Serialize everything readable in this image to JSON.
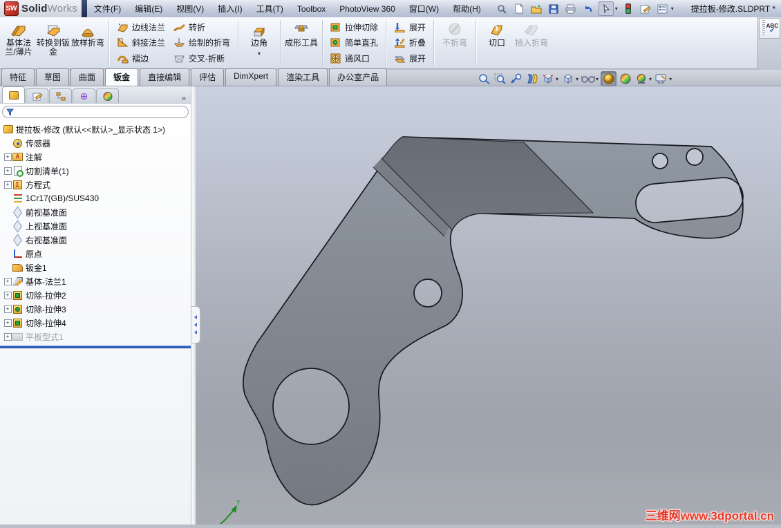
{
  "window": {
    "logo_cube": "SW",
    "app_name_bold": "Solid",
    "app_name_light": "Works",
    "doc_title": "提拉板-修改.SLDPRT *"
  },
  "menu": {
    "items": [
      "文件(F)",
      "编辑(E)",
      "视图(V)",
      "插入(I)",
      "工具(T)",
      "Toolbox",
      "PhotoView 360",
      "窗口(W)",
      "帮助(H)"
    ]
  },
  "quick_toolbar": {
    "icons": [
      "search",
      "new-document",
      "open",
      "save",
      "print",
      "undo",
      "select-cursor",
      "rebuild-traffic-light",
      "file-properties",
      "options"
    ]
  },
  "ribbon": {
    "big_buttons_left": [
      "基体法兰/薄片",
      "转换到钣金",
      "放样折弯"
    ],
    "flange_col": [
      "边线法兰",
      "斜接法兰",
      "褶边"
    ],
    "bend_col": [
      "转折",
      "绘制的折弯",
      "交叉-折断"
    ],
    "corner_button": "边角",
    "forming_button": "成形工具",
    "cut_col": [
      "拉伸切除",
      "简单直孔",
      "通风口"
    ],
    "fold_col": [
      "展开",
      "折叠",
      "展开"
    ],
    "no_bend_button": "不折弯",
    "rip_button": "切口",
    "insert_bend_button": "插入折弯",
    "spell_button": "ABC"
  },
  "command_tabs": {
    "items": [
      "特征",
      "草图",
      "曲面",
      "钣金",
      "直接编辑",
      "评估",
      "DimXpert",
      "渲染工具",
      "办公室产品"
    ],
    "active": "钣金"
  },
  "view_toolbar": {
    "icons": [
      "zoom-fit",
      "zoom-area",
      "zoom-selection",
      "section-view",
      "view-orientation",
      "display-style",
      "hide-show-items",
      "appearance",
      "edit-appearance",
      "apply-scene",
      "view-settings"
    ],
    "pressed": "appearance"
  },
  "feature_panel": {
    "tabs": [
      "feature-manager",
      "property-manager",
      "configuration-manager",
      "dimxpert-manager",
      "display-manager"
    ],
    "overflow_chevron": "»",
    "filter_value": "",
    "tree": {
      "root": "提拉板-修改 (默认<<默认>_显示状态 1>)",
      "items": [
        {
          "label": "传感器",
          "icon": "sensor"
        },
        {
          "label": "注解",
          "icon": "annotations-folder",
          "expandable": true
        },
        {
          "label": "切割清单(1)",
          "icon": "cut-list",
          "expandable": true
        },
        {
          "label": "方程式",
          "icon": "equations",
          "expandable": true
        },
        {
          "label": "1Cr17(GB)/SUS430",
          "icon": "material"
        },
        {
          "label": "前视基准面",
          "icon": "plane"
        },
        {
          "label": "上视基准面",
          "icon": "plane"
        },
        {
          "label": "右视基准面",
          "icon": "plane"
        },
        {
          "label": "原点",
          "icon": "origin"
        },
        {
          "label": "钣金1",
          "icon": "sheet-metal"
        },
        {
          "label": "基体-法兰1",
          "icon": "base-flange",
          "expandable": true
        },
        {
          "label": "切除-拉伸2",
          "icon": "cut-extrude",
          "expandable": true
        },
        {
          "label": "切除-拉伸3",
          "icon": "cut-extrude",
          "expandable": true
        },
        {
          "label": "切除-拉伸4",
          "icon": "cut-extrude",
          "expandable": true
        },
        {
          "label": "平板型式1",
          "icon": "flat-pattern",
          "expandable": true,
          "grayed": true
        }
      ]
    }
  },
  "viewport": {
    "watermark": "三维网www.3dportal.cn",
    "triad_axis_label": "Y"
  },
  "colors": {
    "ribbon_icon_gold": "#f2b245",
    "part_face_light": "#858b95",
    "part_face_dark": "#6a6f78",
    "viewport_top": "#c9d0e0",
    "viewport_bottom": "#a6aab1",
    "rollback_blue": "#2f62c4",
    "watermark_red": "#e23b2e"
  }
}
